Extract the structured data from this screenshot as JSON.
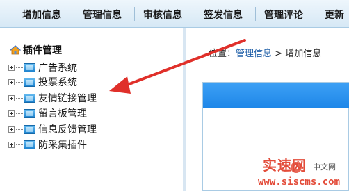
{
  "nav": {
    "items": [
      {
        "label": "增加信息"
      },
      {
        "label": "管理信息"
      },
      {
        "label": "审核信息"
      },
      {
        "label": "签发信息"
      },
      {
        "label": "管理评论"
      },
      {
        "label": "更新"
      }
    ]
  },
  "sidebar": {
    "title": "插件管理",
    "items": [
      {
        "label": "广告系统"
      },
      {
        "label": "投票系统"
      },
      {
        "label": "友情链接管理"
      },
      {
        "label": "留言板管理"
      },
      {
        "label": "信息反馈管理"
      },
      {
        "label": "防采集插件"
      }
    ]
  },
  "breadcrumb": {
    "prefix": "位置：",
    "link": "管理信息",
    "separator": " > ",
    "current": "增加信息"
  },
  "watermark": {
    "title": "实速网",
    "subtitle": "中文网",
    "url": "www.siscms.com"
  },
  "colors": {
    "annotation_arrow": "#e0302a",
    "panel_header": "#2b93ee",
    "watermark": "#e34c3a"
  }
}
